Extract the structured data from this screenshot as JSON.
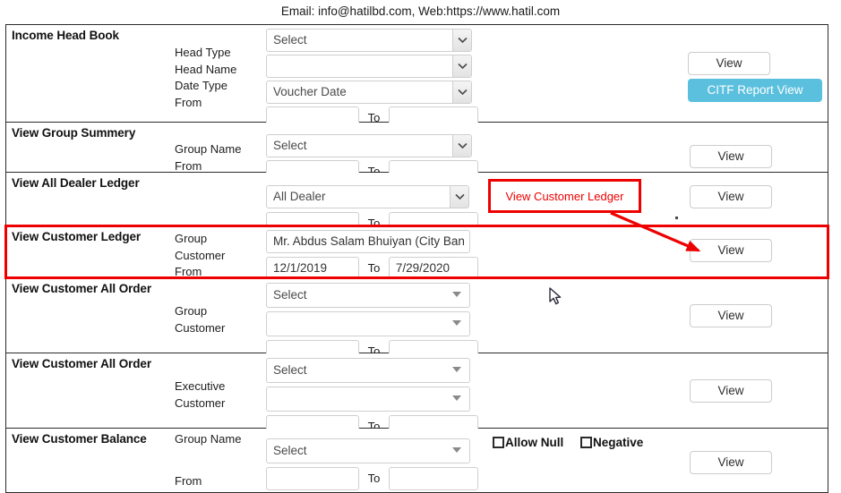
{
  "header": {
    "contact_line": "Email: info@hatilbd.com, Web:https://www.hatil.com"
  },
  "common": {
    "to_label": "To",
    "view_label": "View",
    "select_placeholder": "Select"
  },
  "colors": {
    "citf_button_bg": "#5bc0de",
    "annotation_red": "#ee0000",
    "table_border": "#2b2b2b",
    "input_border": "#cfcfcf"
  },
  "rows": [
    {
      "title": "Income Head Book",
      "labels": [
        "Head Type",
        "Head Name",
        "Date Type",
        "From"
      ],
      "select_1": "Select",
      "select_2": "",
      "select_3": "Voucher Date",
      "from_value": "",
      "to_value": "",
      "to_label": "To",
      "view_label": "View",
      "citf_label": "CITF Report View"
    },
    {
      "title": "View Group Summery",
      "labels": [
        "Group Name",
        "From"
      ],
      "select_1": "Select",
      "from_value": "",
      "to_value": "",
      "to_label": "To",
      "view_label": "View"
    },
    {
      "title": "View All Dealer Ledger",
      "labels": [],
      "select_1": "All Dealer",
      "from_value": "",
      "to_value": "",
      "to_label": "To",
      "view_label": "View"
    },
    {
      "title": "View Customer Ledger",
      "labels": [
        "Group",
        "Customer",
        "From"
      ],
      "text_1": "Mr. Abdus Salam Bhuiyan (City Ban",
      "from_value": "12/1/2019",
      "to_value": "7/29/2020",
      "to_label": "To",
      "view_label": "View"
    },
    {
      "title": "View Customer All Order",
      "labels": [
        "Group",
        "Customer"
      ],
      "select_1": "Select",
      "select_2": "",
      "from_value": "",
      "to_value": "",
      "to_label": "To",
      "view_label": "View"
    },
    {
      "title": "View Customer All Order",
      "labels": [
        "Executive",
        "Customer"
      ],
      "select_1": "Select",
      "select_2": "",
      "from_value": "",
      "to_value": "",
      "to_label": "To",
      "view_label": "View"
    },
    {
      "title": "View Customer Balance",
      "labels_top": "Group Name",
      "labels_bottom": "From",
      "select_1": "Select",
      "from_value": "",
      "to_value": "",
      "to_label": "To",
      "view_label": "View",
      "checkbox_allow_null": "Allow Null",
      "checkbox_negative": "Negative"
    }
  ],
  "annotation": {
    "callout_text": "View Customer Ledger"
  }
}
